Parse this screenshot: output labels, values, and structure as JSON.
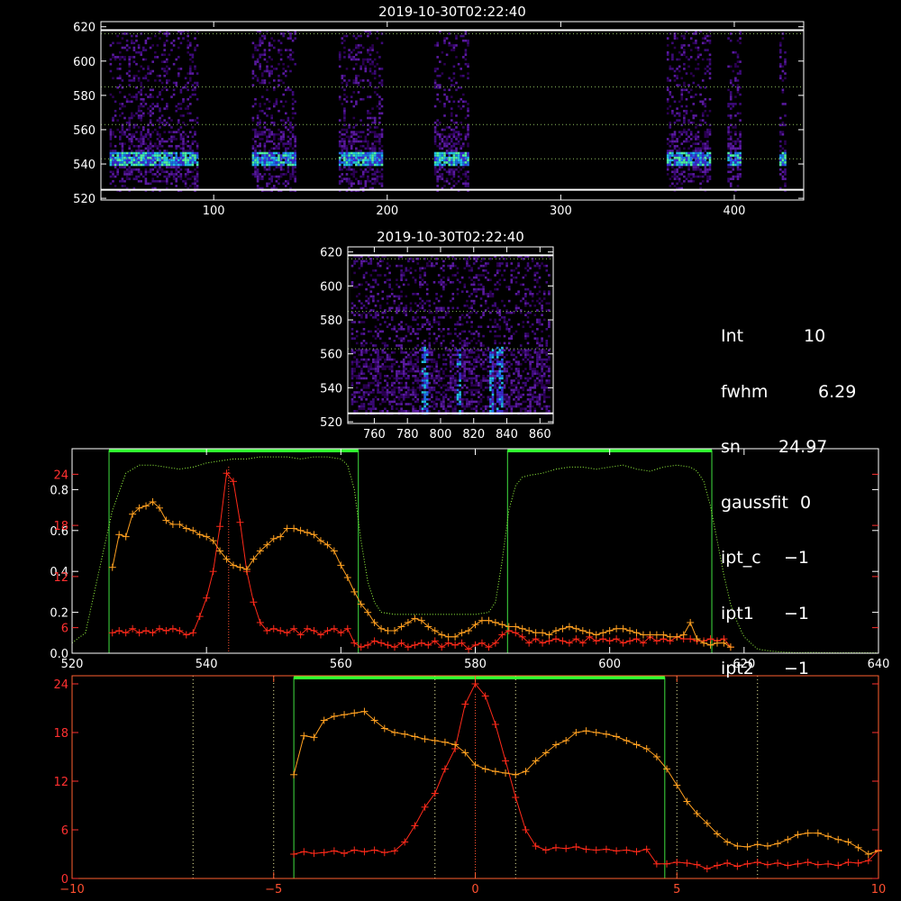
{
  "chart_data": [
    {
      "name": "image-panel-top",
      "type": "heatmap",
      "title": "2019-10-30T02:22:40",
      "xlim": [
        35,
        440
      ],
      "ylim": [
        519,
        623
      ],
      "x_ticks": [
        100,
        200,
        300,
        400
      ],
      "y_ticks": [
        520,
        540,
        560,
        580,
        600,
        620
      ],
      "guide_lines_y": [
        543,
        563,
        585,
        616
      ],
      "border_lines_y": [
        525,
        618
      ],
      "data_columns_x": [
        [
          40,
          90
        ],
        [
          122,
          147
        ],
        [
          172,
          197
        ],
        [
          227,
          246
        ],
        [
          361,
          386
        ],
        [
          396,
          404
        ],
        [
          426,
          430
        ]
      ],
      "emission_line_y": 543
    },
    {
      "name": "image-panel-zoom",
      "type": "heatmap",
      "title": "2019-10-30T02:22:40",
      "xlim": [
        744,
        868
      ],
      "ylim": [
        519,
        623
      ],
      "x_ticks": [
        760,
        780,
        800,
        820,
        840,
        860
      ],
      "y_ticks": [
        520,
        540,
        560,
        580,
        600,
        620
      ],
      "guide_lines_y": [
        563,
        585,
        616
      ],
      "border_lines_y": [
        525,
        618
      ],
      "bright_streaks_x": [
        790,
        810,
        830,
        835
      ]
    },
    {
      "name": "spectrum-panel",
      "type": "line",
      "xlim": [
        520,
        640
      ],
      "x_ticks": [
        520,
        540,
        560,
        580,
        600,
        620,
        640
      ],
      "left_axis_ticks": [
        {
          "value": 0.0,
          "label": "0.0",
          "color": "#ffffff"
        },
        {
          "value": 0.2,
          "label": "0.2",
          "color": "#ffffff"
        },
        {
          "value": 0.4,
          "label": "0.4",
          "color": "#ffffff"
        },
        {
          "value": 0.6,
          "label": "0.6",
          "color": "#ffffff"
        },
        {
          "value": 0.8,
          "label": "0.8",
          "color": "#ffffff"
        },
        {
          "value": 0.125,
          "label": "6",
          "color": "#ff3030"
        },
        {
          "value": 0.375,
          "label": "12",
          "color": "#ff3030"
        },
        {
          "value": 0.625,
          "label": "18",
          "color": "#ff3030"
        },
        {
          "value": 0.875,
          "label": "24",
          "color": "#ff3030"
        }
      ],
      "ylim": [
        0,
        1.0
      ],
      "green_boxes_x": [
        [
          525.5,
          562.6
        ],
        [
          584.8,
          615.2
        ]
      ],
      "center_marker_x": 543.3,
      "series": [
        {
          "color": "#ff2a1a",
          "marker": "+",
          "x": [
            526,
            527,
            528,
            529,
            530,
            531,
            532,
            533,
            534,
            535,
            536,
            537,
            538,
            539,
            540,
            541,
            542,
            543,
            544,
            545,
            546,
            547,
            548,
            549,
            550,
            551,
            552,
            553,
            554,
            555,
            556,
            557,
            558,
            559,
            560,
            561,
            562,
            563,
            564,
            565,
            566,
            567,
            568,
            569,
            570,
            571,
            572,
            573,
            574,
            575,
            576,
            577,
            578,
            579,
            580,
            581,
            582,
            583,
            584,
            585,
            586,
            587,
            588,
            589,
            590,
            591,
            592,
            593,
            594,
            595,
            596,
            597,
            598,
            599,
            600,
            601,
            602,
            603,
            604,
            605,
            606,
            607,
            608,
            609,
            610,
            611,
            612,
            613,
            614,
            615,
            616,
            617,
            618
          ],
          "values": [
            0.1,
            0.11,
            0.1,
            0.12,
            0.1,
            0.11,
            0.1,
            0.12,
            0.11,
            0.12,
            0.11,
            0.09,
            0.1,
            0.18,
            0.27,
            0.4,
            0.62,
            0.88,
            0.84,
            0.64,
            0.4,
            0.25,
            0.15,
            0.11,
            0.12,
            0.11,
            0.1,
            0.12,
            0.09,
            0.12,
            0.11,
            0.09,
            0.11,
            0.12,
            0.1,
            0.12,
            0.05,
            0.03,
            0.04,
            0.06,
            0.05,
            0.04,
            0.03,
            0.05,
            0.03,
            0.04,
            0.05,
            0.04,
            0.06,
            0.03,
            0.05,
            0.04,
            0.05,
            0.02,
            0.04,
            0.05,
            0.03,
            0.05,
            0.09,
            0.11,
            0.1,
            0.08,
            0.05,
            0.07,
            0.05,
            0.06,
            0.07,
            0.06,
            0.05,
            0.07,
            0.05,
            0.08,
            0.06,
            0.07,
            0.06,
            0.07,
            0.05,
            0.06,
            0.07,
            0.05,
            0.08,
            0.06,
            0.07,
            0.06,
            0.08,
            0.07,
            0.07,
            0.06,
            0.06,
            0.07,
            0.06,
            0.07,
            0.03
          ]
        },
        {
          "color": "#ffa020",
          "marker": "+",
          "x": [
            526,
            527,
            528,
            529,
            530,
            531,
            532,
            533,
            534,
            535,
            536,
            537,
            538,
            539,
            540,
            541,
            542,
            543,
            544,
            545,
            546,
            547,
            548,
            549,
            550,
            551,
            552,
            553,
            554,
            555,
            556,
            557,
            558,
            559,
            560,
            561,
            562,
            563,
            564,
            565,
            566,
            567,
            568,
            569,
            570,
            571,
            572,
            573,
            574,
            575,
            576,
            577,
            578,
            579,
            580,
            581,
            582,
            583,
            584,
            585,
            586,
            587,
            588,
            589,
            590,
            591,
            592,
            593,
            594,
            595,
            596,
            597,
            598,
            599,
            600,
            601,
            602,
            603,
            604,
            605,
            606,
            607,
            608,
            609,
            610,
            611,
            612,
            613,
            614,
            615,
            616,
            617,
            618
          ],
          "values": [
            0.42,
            0.58,
            0.57,
            0.68,
            0.71,
            0.72,
            0.74,
            0.71,
            0.65,
            0.63,
            0.63,
            0.61,
            0.6,
            0.58,
            0.57,
            0.55,
            0.5,
            0.46,
            0.43,
            0.42,
            0.41,
            0.46,
            0.5,
            0.53,
            0.56,
            0.57,
            0.61,
            0.61,
            0.6,
            0.59,
            0.58,
            0.55,
            0.53,
            0.5,
            0.43,
            0.37,
            0.3,
            0.24,
            0.2,
            0.15,
            0.12,
            0.11,
            0.11,
            0.13,
            0.15,
            0.17,
            0.16,
            0.13,
            0.11,
            0.09,
            0.08,
            0.08,
            0.1,
            0.11,
            0.14,
            0.16,
            0.16,
            0.15,
            0.14,
            0.13,
            0.13,
            0.12,
            0.11,
            0.1,
            0.1,
            0.09,
            0.11,
            0.12,
            0.13,
            0.12,
            0.11,
            0.1,
            0.09,
            0.1,
            0.11,
            0.12,
            0.12,
            0.11,
            0.1,
            0.09,
            0.09,
            0.09,
            0.09,
            0.08,
            0.08,
            0.09,
            0.15,
            0.07,
            0.05,
            0.04,
            0.05,
            0.05,
            0.03
          ]
        },
        {
          "color": "#9aff40",
          "marker": "dotted",
          "x": [
            520,
            522,
            524,
            526,
            528,
            530,
            532,
            534,
            536,
            538,
            540,
            542,
            544,
            546,
            548,
            550,
            552,
            554,
            556,
            558,
            560,
            561,
            562,
            563,
            564,
            565,
            566,
            568,
            570,
            572,
            574,
            576,
            578,
            580,
            582,
            583,
            584,
            585,
            586,
            587,
            588,
            590,
            592,
            594,
            596,
            598,
            600,
            602,
            604,
            606,
            608,
            610,
            612,
            613,
            614,
            615,
            616,
            617,
            618,
            619,
            620,
            622,
            624,
            626,
            628,
            630,
            632,
            634,
            636,
            638,
            640
          ],
          "values": [
            0.05,
            0.1,
            0.4,
            0.7,
            0.88,
            0.92,
            0.92,
            0.91,
            0.9,
            0.91,
            0.93,
            0.94,
            0.95,
            0.95,
            0.96,
            0.96,
            0.96,
            0.95,
            0.96,
            0.96,
            0.95,
            0.92,
            0.8,
            0.55,
            0.35,
            0.25,
            0.2,
            0.19,
            0.19,
            0.19,
            0.19,
            0.19,
            0.19,
            0.19,
            0.2,
            0.25,
            0.45,
            0.7,
            0.82,
            0.86,
            0.87,
            0.88,
            0.9,
            0.91,
            0.91,
            0.9,
            0.91,
            0.92,
            0.9,
            0.89,
            0.91,
            0.92,
            0.91,
            0.89,
            0.84,
            0.72,
            0.55,
            0.38,
            0.24,
            0.15,
            0.08,
            0.02,
            0.01,
            0.005,
            0.003,
            0.004,
            0.003,
            0.002,
            0.003,
            0.002,
            0.002
          ]
        }
      ]
    },
    {
      "name": "zoom-panel",
      "type": "line",
      "xlim": [
        -10,
        10
      ],
      "x_ticks": [
        -10,
        -5,
        0,
        5,
        10
      ],
      "left_axis_ticks": [
        {
          "value": 0,
          "label": "0",
          "color": "#ff3030"
        },
        {
          "value": 6,
          "label": "6",
          "color": "#ff3030"
        },
        {
          "value": 12,
          "label": "12",
          "color": "#ff3030"
        },
        {
          "value": 18,
          "label": "18",
          "color": "#ff3030"
        },
        {
          "value": 24,
          "label": "24",
          "color": "#ff3030"
        }
      ],
      "ylim": [
        0,
        25
      ],
      "green_box_x": [
        -4.5,
        4.7
      ],
      "dotted_white_x": [
        -7,
        -5,
        -1,
        1,
        5,
        7
      ],
      "center_marker_x": 0,
      "series": [
        {
          "color": "#ff2a1a",
          "marker": "+",
          "x": [
            -4.5,
            -4.25,
            -4.0,
            -3.75,
            -3.5,
            -3.25,
            -3.0,
            -2.75,
            -2.5,
            -2.25,
            -2.0,
            -1.75,
            -1.5,
            -1.25,
            -1.0,
            -0.75,
            -0.5,
            -0.25,
            0.0,
            0.25,
            0.5,
            0.75,
            1.0,
            1.25,
            1.5,
            1.75,
            2.0,
            2.25,
            2.5,
            2.75,
            3.0,
            3.25,
            3.5,
            3.75,
            4.0,
            4.25,
            4.5,
            4.75,
            5.0,
            5.25,
            5.5,
            5.75,
            6.0,
            6.25,
            6.5,
            6.75,
            7.0,
            7.25,
            7.5,
            7.75,
            8.0,
            8.25,
            8.5,
            8.75,
            9.0,
            9.25,
            9.5,
            9.75,
            10.0
          ],
          "values": [
            3.0,
            3.3,
            3.1,
            3.2,
            3.4,
            3.1,
            3.5,
            3.3,
            3.5,
            3.2,
            3.4,
            4.5,
            6.5,
            8.8,
            10.5,
            13.5,
            16.0,
            21.5,
            24.0,
            22.5,
            19.0,
            14.5,
            10.0,
            6.0,
            4.0,
            3.5,
            3.8,
            3.7,
            3.9,
            3.6,
            3.5,
            3.6,
            3.4,
            3.5,
            3.3,
            3.6,
            1.8,
            1.8,
            2.0,
            1.9,
            1.7,
            1.2,
            1.6,
            1.9,
            1.5,
            1.8,
            2.0,
            1.7,
            1.9,
            1.6,
            1.8,
            2.0,
            1.7,
            1.8,
            1.6,
            2.0,
            1.9,
            2.2,
            3.5
          ]
        },
        {
          "color": "#ffa020",
          "marker": "+",
          "x": [
            -4.5,
            -4.25,
            -4.0,
            -3.75,
            -3.5,
            -3.25,
            -3.0,
            -2.75,
            -2.5,
            -2.25,
            -2.0,
            -1.75,
            -1.5,
            -1.25,
            -1.0,
            -0.75,
            -0.5,
            -0.25,
            0.0,
            0.25,
            0.5,
            0.75,
            1.0,
            1.25,
            1.5,
            1.75,
            2.0,
            2.25,
            2.5,
            2.75,
            3.0,
            3.25,
            3.5,
            3.75,
            4.0,
            4.25,
            4.5,
            4.75,
            5.0,
            5.25,
            5.5,
            5.75,
            6.0,
            6.25,
            6.5,
            6.75,
            7.0,
            7.25,
            7.5,
            7.75,
            8.0,
            8.25,
            8.5,
            8.75,
            9.0,
            9.25,
            9.5,
            9.75,
            10.0
          ],
          "values": [
            12.8,
            17.6,
            17.4,
            19.5,
            20.0,
            20.2,
            20.4,
            20.6,
            19.5,
            18.5,
            18.0,
            17.8,
            17.5,
            17.2,
            17.0,
            16.8,
            16.5,
            15.5,
            14.0,
            13.5,
            13.2,
            13.0,
            12.8,
            13.2,
            14.5,
            15.5,
            16.5,
            17.0,
            18.0,
            18.2,
            18.0,
            17.8,
            17.5,
            17.0,
            16.5,
            16.0,
            15.0,
            13.5,
            11.5,
            9.5,
            8.0,
            6.8,
            5.5,
            4.5,
            4.0,
            3.9,
            4.2,
            4.0,
            4.3,
            4.8,
            5.4,
            5.6,
            5.6,
            5.2,
            4.8,
            4.5,
            3.8,
            3.0,
            3.4
          ]
        }
      ]
    }
  ],
  "info_panel": {
    "rows": [
      {
        "key": "Int",
        "value": "10"
      },
      {
        "key": "fwhm",
        "value": "6.29"
      },
      {
        "key": "sn",
        "value": "24.97"
      },
      {
        "key": "gaussfit",
        "value": "0"
      },
      {
        "key": "ipt_c",
        "value": "−1"
      },
      {
        "key": "ipt1",
        "value": "−1"
      },
      {
        "key": "ipt2",
        "value": "−1"
      }
    ]
  }
}
